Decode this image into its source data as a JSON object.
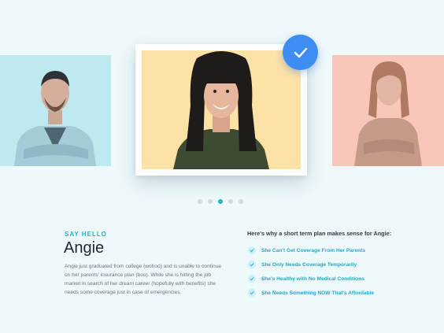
{
  "carousel": {
    "people": [
      {
        "name": "man-left",
        "bg": "#bfe9f0"
      },
      {
        "name": "Angie",
        "bg": "#fde2a6"
      },
      {
        "name": "woman-right",
        "bg": "#f9c7ba"
      }
    ],
    "selected_icon": "checkmark-icon",
    "accent": "#3d8df3",
    "page_count": 5,
    "active_page": 3
  },
  "profile": {
    "eyebrow": "SAY HELLO",
    "name": "Angie",
    "bio": "Angie just graduated from college (wohoo) and is unable to continue on her parents' insurance plan (boo). While she is hitting the job market in search of her dream career (hopefully with benefits) she needs some coverage just in case of emergencies."
  },
  "reasons": {
    "title": "Here's why a short term plan makes sense for Angie:",
    "icon": "check-circle-icon",
    "items": [
      {
        "label": "She Can't Get Coverage From Her Parents"
      },
      {
        "label": "She Only Needs Coverage Temporarily"
      },
      {
        "label": "She's Healthy with No Medical Conditions"
      },
      {
        "label": "She Needs Something NOW That's Affordable"
      }
    ]
  }
}
